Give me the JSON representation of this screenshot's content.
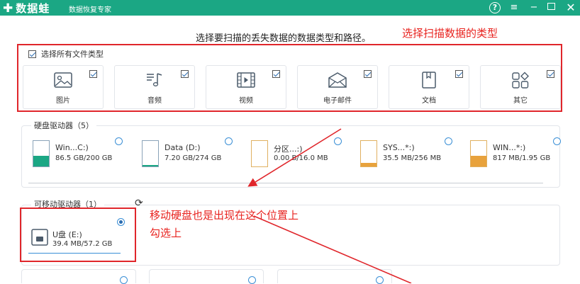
{
  "app": {
    "name": "数据蛙",
    "subtitle": "数据恢复专家",
    "help_label": "?",
    "menu_label": "≡",
    "min_label": "−",
    "close_label": "✕"
  },
  "prompt": "选择要扫描的丢失数据的数据类型和路径。",
  "annotations": {
    "file_types": "选择扫描数据的类型",
    "removable_1": "移动硬盘也是出现在这个位置上",
    "removable_2": "勾选上"
  },
  "select_all_label": "选择所有文件类型",
  "file_types": [
    {
      "label": "图片",
      "icon": "image-icon",
      "checked": true
    },
    {
      "label": "音频",
      "icon": "music-icon",
      "checked": true
    },
    {
      "label": "视频",
      "icon": "video-icon",
      "checked": true
    },
    {
      "label": "电子邮件",
      "icon": "email-icon",
      "checked": true
    },
    {
      "label": "文档",
      "icon": "document-icon",
      "checked": true
    },
    {
      "label": "其它",
      "icon": "other-icon",
      "checked": true
    }
  ],
  "hard_drives": {
    "title": "硬盘驱动器（5）",
    "items": [
      {
        "name": "Win...C:)",
        "size": "86.5 GB/200 GB",
        "used": 0.43,
        "fill_color": "#1ba784"
      },
      {
        "name": "Data (D:)",
        "size": "7.20 GB/274 GB",
        "used": 0.03,
        "fill_color": "#1ba784"
      },
      {
        "name": "分区...:)",
        "size": "0.00  B/16.0 MB",
        "used": 0.0,
        "fill_color": "#e8a23c"
      },
      {
        "name": "SYS...*:)",
        "size": "35.5 MB/256 MB",
        "used": 0.14,
        "fill_color": "#e8a23c"
      },
      {
        "name": "WIN...*:)",
        "size": "817 MB/1.95 GB",
        "used": 0.42,
        "fill_color": "#e8a23c"
      }
    ]
  },
  "removable": {
    "title": "可移动驱动器（1）",
    "items": [
      {
        "name": "U盘 (E:)",
        "size": "39.4 MB/57.2 GB",
        "selected": true
      }
    ]
  },
  "colors": {
    "titlebar": "#1ba784",
    "annotation": "#e8231f",
    "radio": "#3a8fd6"
  }
}
